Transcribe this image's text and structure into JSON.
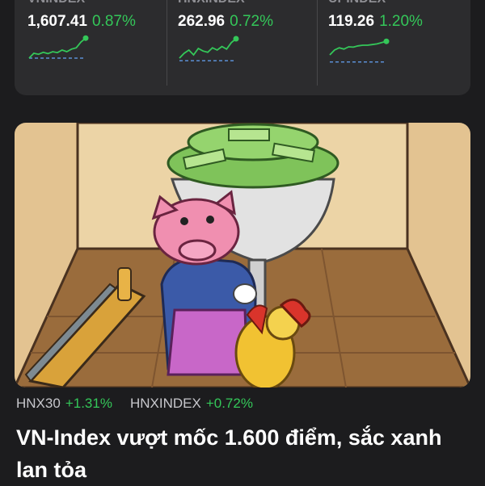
{
  "indices": [
    {
      "name": "VNINDEX",
      "value": "1,607.41",
      "change": "0.87%",
      "spark": [
        0.3,
        0.45,
        0.42,
        0.48,
        0.44,
        0.5,
        0.47,
        0.55,
        0.5,
        0.58,
        0.62,
        0.8,
        0.92
      ],
      "baseline": 0.3
    },
    {
      "name": "HNXINDEX",
      "value": "262.96",
      "change": "0.72%",
      "spark": [
        0.3,
        0.45,
        0.55,
        0.4,
        0.6,
        0.52,
        0.48,
        0.62,
        0.55,
        0.66,
        0.58,
        0.78,
        0.9
      ],
      "baseline": 0.22
    },
    {
      "name": "UPINDEX",
      "value": "119.26",
      "change": "1.20%",
      "spark": [
        0.4,
        0.55,
        0.62,
        0.58,
        0.65,
        0.64,
        0.68,
        0.7,
        0.7,
        0.72,
        0.74,
        0.78,
        0.82
      ],
      "baseline": 0.18
    }
  ],
  "article": {
    "tags": [
      {
        "name": "HNX30",
        "change": "+1.31%"
      },
      {
        "name": "HNXINDEX",
        "change": "+0.72%"
      }
    ],
    "headline": "VN-Index vượt mốc 1.600 điểm, sắc xanh lan tỏa"
  },
  "colors": {
    "up": "#34c759",
    "background": "#1c1c1e",
    "card": "#2c2c2e",
    "baseline": "#5b8fd4"
  }
}
